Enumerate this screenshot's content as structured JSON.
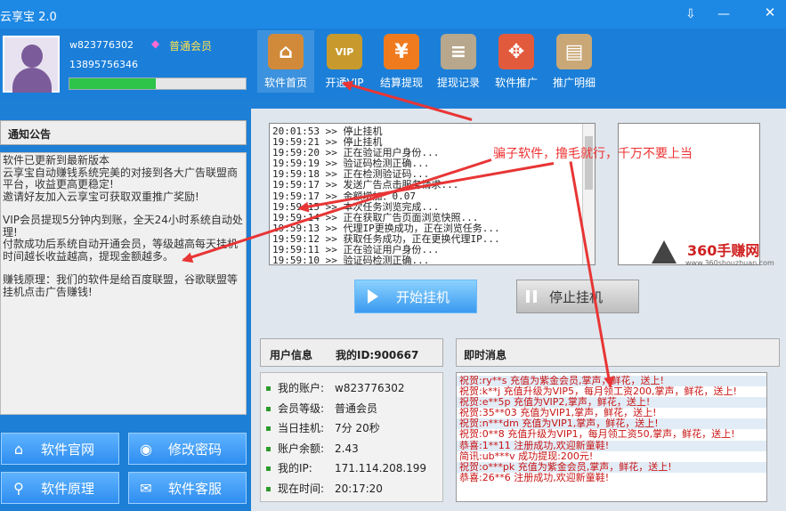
{
  "window": {
    "title": "云享宝 2.0"
  },
  "user": {
    "username": "w823776302",
    "phone": "13895756346",
    "level": "普通会员",
    "progress_percent": 49
  },
  "nav": [
    {
      "label": "软件首页",
      "icon": "home-icon",
      "color": "#d08a3a",
      "glyph": "⌂"
    },
    {
      "label": "开通VIP",
      "icon": "vip-icon",
      "color": "#c89a2e",
      "glyph": "VIP"
    },
    {
      "label": "结算提现",
      "icon": "yuan-icon",
      "color": "#f07b1f",
      "glyph": "¥"
    },
    {
      "label": "提现记录",
      "icon": "clipboard-icon",
      "color": "#b7a78c",
      "glyph": "≡"
    },
    {
      "label": "软件推广",
      "icon": "move-arrows-icon",
      "color": "#e25a3c",
      "glyph": "✥"
    },
    {
      "label": "推广明细",
      "icon": "book-icon",
      "color": "#c9a776",
      "glyph": "▤"
    }
  ],
  "notice": {
    "heading": "通知公告",
    "paragraphs": [
      "软件已更新到最新版本\n云享宝自动赚钱系统完美的对接到各大广告联盟商平台，收益更高更稳定!\n邀请好友加入云享宝可获取双重推广奖励!",
      "VIP会员提现5分钟内到账，全天24小时系统自动处理!\n付款成功后系统自动开通会员，等级越高每天挂机时间越长收益越高，提现金额越多。",
      "赚钱原理：我们的软件是给百度联盟，谷歌联盟等挂机点击广告赚钱!"
    ]
  },
  "left_buttons": [
    {
      "label": "软件官网",
      "icon": "home-icon",
      "glyph": "⌂"
    },
    {
      "label": "修改密码",
      "icon": "eye-icon",
      "glyph": "◉"
    },
    {
      "label": "软件原理",
      "icon": "search-icon",
      "glyph": "⚲"
    },
    {
      "label": "软件客服",
      "icon": "chat-icon",
      "glyph": "✉"
    }
  ],
  "log": [
    "20:01:53 >> 停止挂机",
    "19:59:21 >> 停止挂机",
    "19:59:20 >> 正在验证用户身份...",
    "19:59:19 >> 验证码检测正确...",
    "19:59:18 >> 正在检测验证码...",
    "19:59:17 >> 发送广告点击服务请求...",
    "19:59:17 >> 金额增加：0.07",
    "19:59:15 >> 本次任务浏览完成...",
    "19:59:14 >> 正在获取广告页面浏览快照...",
    "19:59:13 >> 代理IP更换成功，正在浏览任务...",
    "19:59:12 >> 获取任务成功，正在更换代理IP...",
    "19:59:11 >> 正在验证用户身份...",
    "19:59:10 >> 验证码检测正确..."
  ],
  "annotation": "骗子软件，撸毛就行，千万不要上当",
  "ad": {
    "brand": "360手赚网",
    "url": "www.360shouzhuan.com"
  },
  "controls": {
    "start_label": "开始挂机",
    "stop_label": "停止挂机"
  },
  "user_info": {
    "heading": "用户信息",
    "id_label": "我的ID:900667",
    "rows": [
      {
        "label": "我的账户:",
        "value": "w823776302"
      },
      {
        "label": "会员等级:",
        "value": "普通会员"
      },
      {
        "label": "当日挂机:",
        "value": "7分 20秒"
      },
      {
        "label": "账户余额:",
        "value": "2.43"
      },
      {
        "label": "我的IP:",
        "value": "171.114.208.199"
      },
      {
        "label": "现在时间:",
        "value": "20:17:20"
      }
    ]
  },
  "messages": {
    "heading": "即时消息",
    "lines": [
      "祝贺:ry**s 充值为紫金会员,掌声，鲜花，送上!",
      "祝贺:k**j 充值升级为VIP5，每月领工资200,掌声，鲜花，送上!",
      "祝贺:e**5p 充值为VIP2,掌声，鲜花，送上!",
      "祝贺:35**03 充值为VIP1,掌声，鲜花，送上!",
      "祝贺:n***dm 充值为VIP1,掌声，鲜花，送上!",
      "祝贺:0**8 充值升级为VIP1，每月领工资50,掌声，鲜花，送上!",
      "恭喜:1**11 注册成功,欢迎新童鞋!",
      "简讯:ub***v 成功提现:200元!",
      "祝贺:o***pk 充值为紫金会员,掌声，鲜花，送上!",
      "恭喜:26**6 注册成功,欢迎新童鞋!"
    ]
  },
  "colors": {
    "accent": "#1e7fd6",
    "alert_red": "#e33333",
    "progress_green": "#2ec44a"
  }
}
